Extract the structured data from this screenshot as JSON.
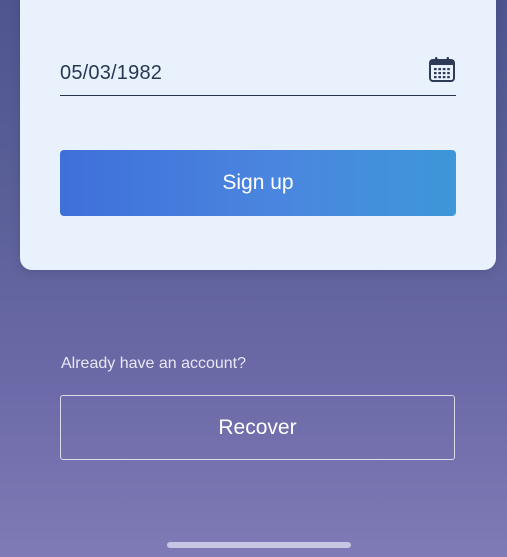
{
  "form": {
    "date_of_birth_value": "05/03/1982",
    "signup_label": "Sign up"
  },
  "footer": {
    "account_prompt": "Already have an account?",
    "recover_label": "Recover"
  },
  "icons": {
    "calendar": "calendar-icon"
  },
  "colors": {
    "card_background": "#e9f1fc",
    "primary_gradient_start": "#3f6fd9",
    "primary_gradient_end": "#3d97d8",
    "background_top": "#4e5590",
    "background_bottom": "#7f7bb7"
  }
}
